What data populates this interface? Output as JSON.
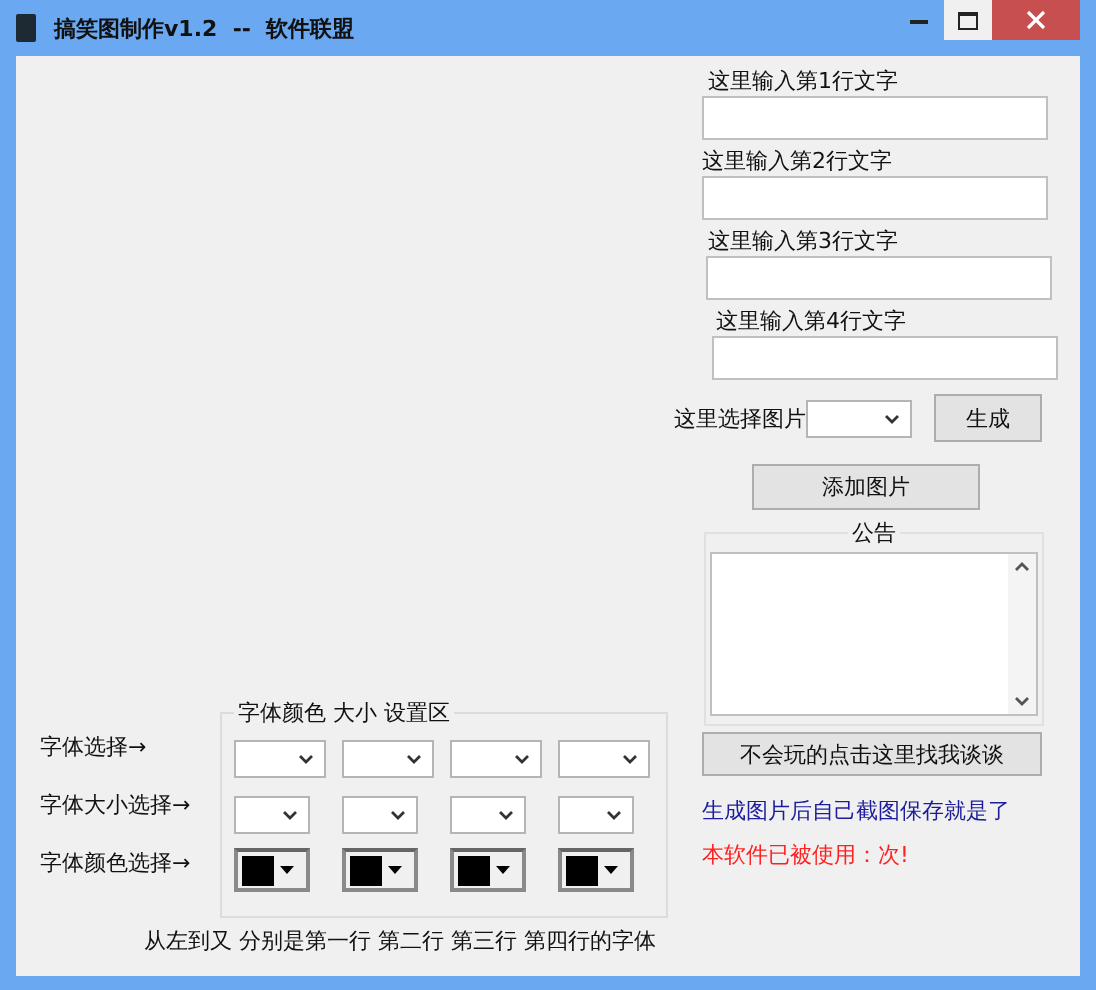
{
  "window": {
    "title": "搞笑图制作v1.2  --  软件联盟"
  },
  "text_inputs": [
    {
      "label": "这里输入第1行文字"
    },
    {
      "label": "这里输入第2行文字"
    },
    {
      "label": "这里输入第3行文字"
    },
    {
      "label": "这里输入第4行文字"
    }
  ],
  "image_picker": {
    "label": "这里选择图片"
  },
  "generate_button": "生成",
  "add_image_button": "添加图片",
  "notice": {
    "title": "公告"
  },
  "help_button": "不会玩的点击这里找我谈谈",
  "info_text": "生成图片后自己截图保存就是了",
  "usage_text": "本软件已被使用：次!",
  "font_settings": {
    "title": "字体颜色 大小 设置区",
    "rows": [
      {
        "label": "字体选择→",
        "cells": [
          {
            "kind": "dropdown"
          },
          {
            "kind": "dropdown"
          },
          {
            "kind": "dropdown"
          },
          {
            "kind": "dropdown"
          }
        ]
      },
      {
        "label": "字体大小选择→",
        "cells": [
          {
            "kind": "small-dropdown"
          },
          {
            "kind": "small-dropdown"
          },
          {
            "kind": "small-dropdown"
          },
          {
            "kind": "small-dropdown"
          }
        ]
      },
      {
        "label": "字体颜色选择→",
        "cells": [
          {
            "kind": "color",
            "color": "#000000"
          },
          {
            "kind": "color",
            "color": "#000000"
          },
          {
            "kind": "color",
            "color": "#000000"
          },
          {
            "kind": "color",
            "color": "#000000"
          }
        ]
      }
    ],
    "note": "从左到又 分别是第一行 第二行 第三行 第四行的字体"
  }
}
